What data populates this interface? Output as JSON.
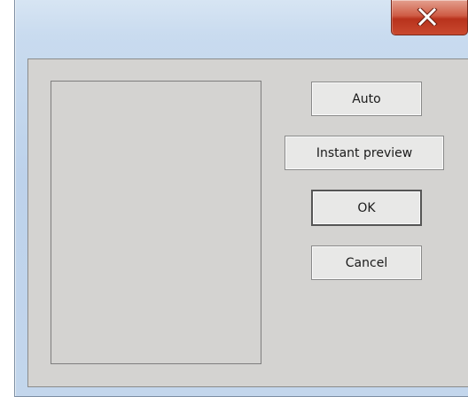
{
  "titlebar": {
    "close_icon": "close-icon"
  },
  "buttons": {
    "auto_label": "Auto",
    "instant_preview_label": "Instant preview",
    "ok_label": "OK",
    "cancel_label": "Cancel"
  },
  "colors": {
    "close_button": "#c9492f",
    "client_background": "#d4d3d1",
    "titlebar": "#c9dbef"
  }
}
